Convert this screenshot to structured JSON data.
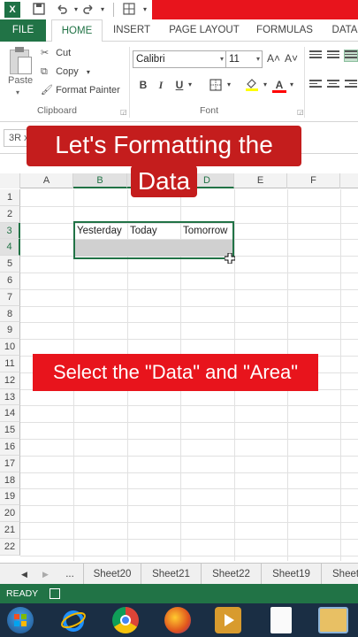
{
  "titlebar": {
    "icons": [
      "excel-logo-icon",
      "save-icon",
      "undo-icon",
      "redo-icon",
      "borders-icon"
    ],
    "accent_color": "#e8141c"
  },
  "tabs": [
    "FILE",
    "HOME",
    "INSERT",
    "PAGE LAYOUT",
    "FORMULAS",
    "DATA"
  ],
  "ribbon": {
    "paste_label": "Paste",
    "cut_label": "Cut",
    "copy_label": "Copy",
    "format_painter_label": "Format Painter",
    "clipboard_group": "Clipboard",
    "font_group": "Font",
    "font_name": "Calibri",
    "font_size": "11",
    "bold": "B",
    "italic": "I",
    "underline": "U",
    "grow_font": "A˄",
    "shrink_font": "A˅",
    "font_color_letter": "A"
  },
  "name_box": "3R x",
  "captions": {
    "line1": "Let's Formatting the",
    "line2": "Data",
    "instruction": "Select the \"Data\" and \"Area\""
  },
  "grid": {
    "columns": [
      "A",
      "B",
      "C",
      "D",
      "E",
      "F"
    ],
    "rows": [
      "1",
      "2",
      "3",
      "4",
      "5",
      "6",
      "7",
      "8",
      "9",
      "10",
      "11",
      "12",
      "13",
      "14",
      "15",
      "16",
      "17",
      "18",
      "19",
      "20",
      "21",
      "22"
    ],
    "cells": {
      "B3": "Yesterday",
      "C3": "Today",
      "D3": "Tomorrow"
    }
  },
  "sheet_tabs": [
    "...",
    "Sheet20",
    "Sheet21",
    "Sheet22",
    "Sheet19",
    "Sheet"
  ],
  "status": {
    "ready": "READY"
  },
  "taskbar": {
    "apps": [
      "windows-start-icon",
      "internet-explorer-icon",
      "chrome-icon",
      "firefox-icon",
      "media-player-icon",
      "file-icon",
      "file-explorer-icon"
    ]
  },
  "colors": {
    "excel_green": "#217346",
    "caption_red": "#c41d1d",
    "taskbar": "#1a2e44"
  }
}
